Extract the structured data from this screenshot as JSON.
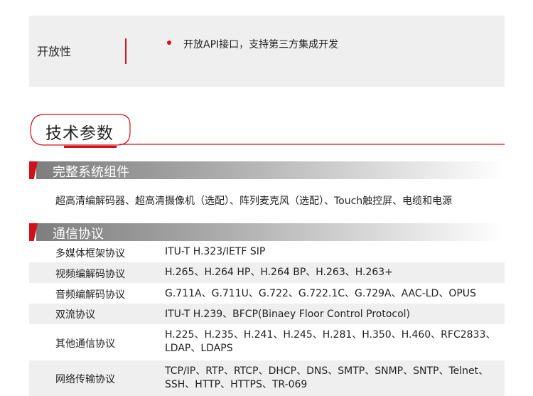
{
  "openness": {
    "label": "开放性",
    "bullet": "开放API接口，支持第三方集成开发"
  },
  "tech_params": {
    "title": "技术参数"
  },
  "system_components": {
    "header": "完整系统组件",
    "text": "超高清编解码器、超高清摄像机（选配）、阵列麦克风（选配）、Touch触控屏、电缆和电源"
  },
  "protocols": {
    "header": "通信协议",
    "rows": [
      {
        "key": "多媒体框架协议",
        "value": "ITU-T H.323/IETF SIP"
      },
      {
        "key": "视频编解码协议",
        "value": "H.265、H.264 HP、H.264 BP、H.263、H.263+"
      },
      {
        "key": "音频编解码协议",
        "value": "G.711A、G.711U、G.722、G.722.1C、G.729A、AAC-LD、OPUS"
      },
      {
        "key": "双流协议",
        "value": "ITU-T H.239、BFCP(Binaey Floor Control Protocol)"
      },
      {
        "key": "其他通信协议",
        "value": "H.225、H.235、H.241、H.245、H.281、H.350、H.460、RFC2833、LDAP、LDAPS"
      },
      {
        "key": "网络传输协议",
        "value": "TCP/IP、RTP、RTCP、DHCP、DNS、SMTP、SNMP、SNTP、Telnet、SSH、HTTP、HTTPS、TR-069"
      }
    ]
  },
  "colors": {
    "accent": "#d0101a",
    "panel": "#efefef"
  }
}
